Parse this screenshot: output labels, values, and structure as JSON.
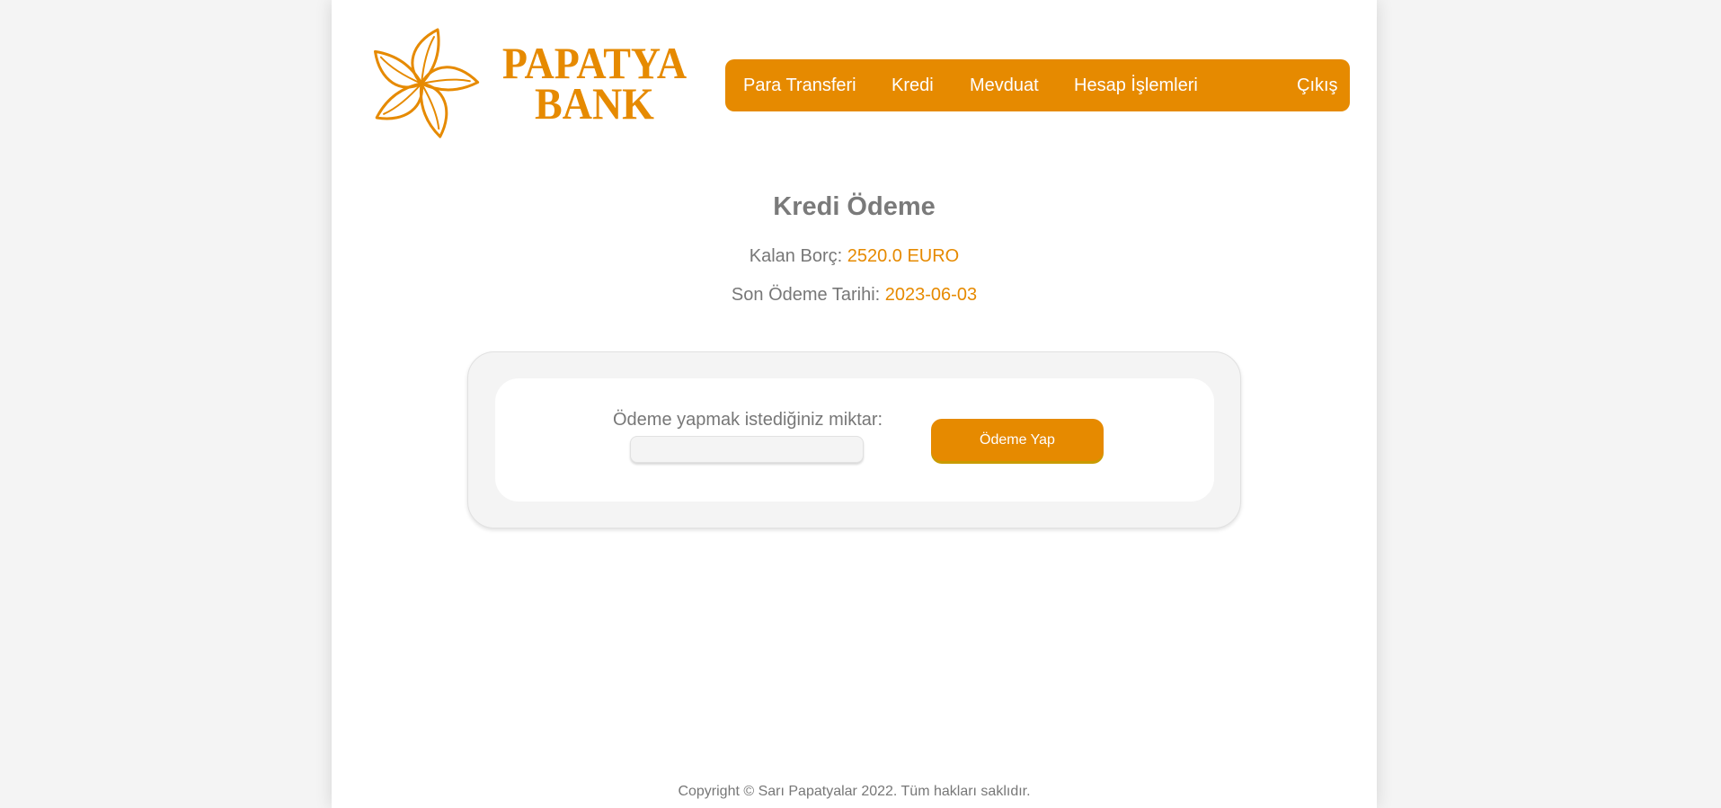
{
  "brand": {
    "logo_line1": "PAPATYA",
    "logo_line2": "BANK",
    "accent_color": "#e68a00",
    "logo_icon": "flower-icon"
  },
  "nav": {
    "items": [
      {
        "label": "Para Transferi"
      },
      {
        "label": "Kredi"
      },
      {
        "label": "Mevduat"
      },
      {
        "label": "Hesap İşlemleri"
      }
    ],
    "logout_label": "Çıkış"
  },
  "main": {
    "title": "Kredi Ödeme",
    "remaining_debt_label": "Kalan Borç:",
    "remaining_debt_value": "2520.0 EURO",
    "due_date_label": "Son Ödeme Tarihi:",
    "due_date_value": "2023-06-03"
  },
  "payment_form": {
    "amount_label": "Ödeme yapmak istediğiniz miktar:",
    "amount_value": "",
    "submit_label": "Ödeme Yap"
  },
  "footer": {
    "copyright": "Copyright © Sarı Papatyalar 2022. Tüm hakları saklıdır."
  }
}
